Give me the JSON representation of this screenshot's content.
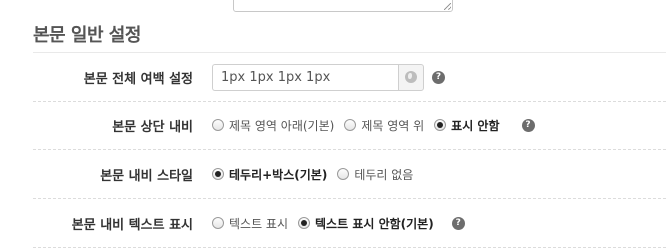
{
  "section": {
    "title": "본문 일반 설정"
  },
  "settings": [
    {
      "label": "본문 전체 여백 설정",
      "input_value": "1px 1px 1px 1px",
      "help": "?"
    },
    {
      "label": "본문 상단 내비",
      "options": [
        "제목 영역 아래(기본)",
        "제목 영역 위",
        "표시 안함"
      ],
      "selected": "표시 안함",
      "help": "?"
    },
    {
      "label": "본문 내비 스타일",
      "options": [
        "테두리+박스(기본)",
        "테두리 없음"
      ],
      "selected": "테두리+박스(기본)"
    },
    {
      "label": "본문 내비 텍스트 표시",
      "options": [
        "텍스트 표시",
        "텍스트 표시 안함(기본)"
      ],
      "selected": "텍스트 표시 안함(기본)",
      "help": "?"
    }
  ]
}
